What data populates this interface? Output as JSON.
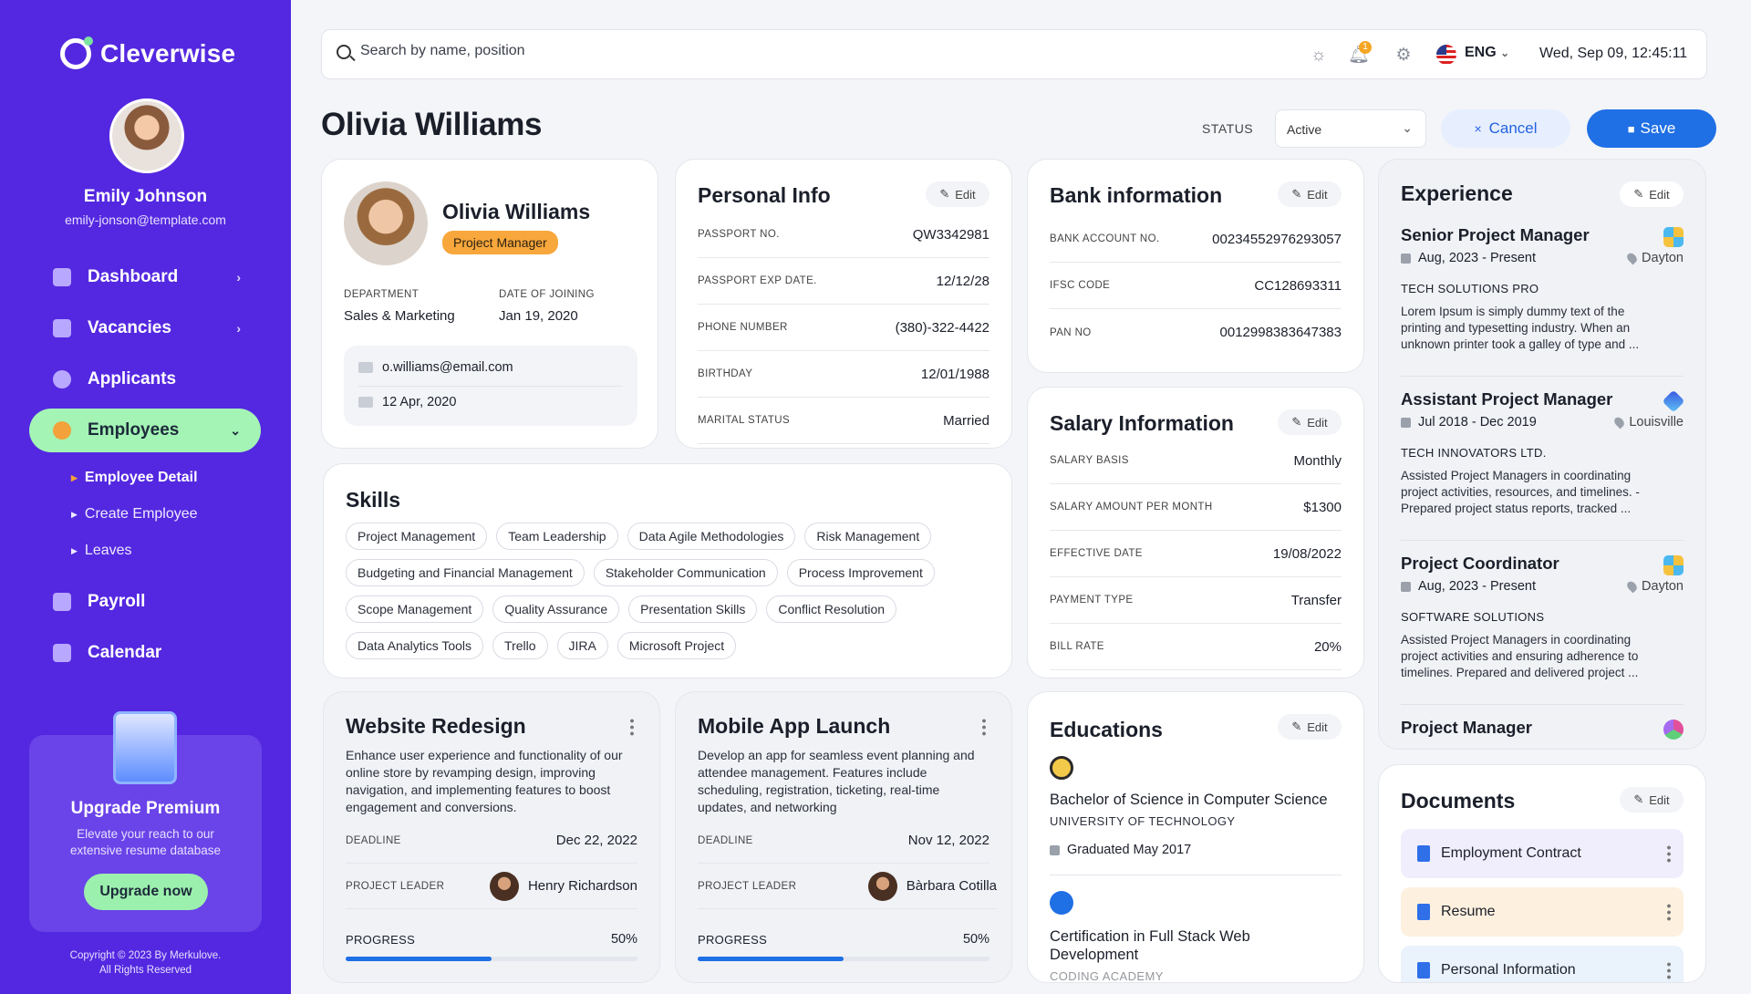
{
  "app": {
    "brand": "Cleverwise"
  },
  "user": {
    "name": "Emily Johnson",
    "email": "emily-jonson@template.com"
  },
  "nav": {
    "items": [
      {
        "label": "Dashboard",
        "icon": "pie-chart-icon"
      },
      {
        "label": "Vacancies",
        "icon": "briefcase-icon"
      },
      {
        "label": "Applicants",
        "icon": "user-icon"
      },
      {
        "label": "Employees",
        "icon": "users-icon"
      },
      {
        "label": "Payroll",
        "icon": "wallet-icon"
      },
      {
        "label": "Calendar",
        "icon": "calendar-icon"
      }
    ],
    "sub": [
      {
        "label": "Employee Detail"
      },
      {
        "label": "Create Employee"
      },
      {
        "label": "Leaves"
      }
    ]
  },
  "premium": {
    "title": "Upgrade Premium",
    "text": "Elevate your reach to our extensive resume database",
    "button": "Upgrade now"
  },
  "copyright": {
    "line1": "Copyright © 2023 By Merkulove.",
    "line2": "All Rights Reserved"
  },
  "topbar": {
    "search_placeholder": "Search by name, position",
    "notif_count": "1",
    "lang": "ENG",
    "datetime": "Wed, Sep 09, 12:45:11"
  },
  "page": {
    "title": "Olivia Williams",
    "status_label": "STATUS",
    "status_value": "Active",
    "cancel": "Cancel",
    "save": "Save"
  },
  "profile": {
    "name": "Olivia Williams",
    "role": "Project Manager",
    "department_label": "DEPARTMENT",
    "department": "Sales & Marketing",
    "joining_label": "DATE OF JOINING",
    "joining": "Jan 19, 2020",
    "email": "o.williams@email.com",
    "date": "12 Apr, 2020"
  },
  "edit_label": "Edit",
  "personal": {
    "title": "Personal Info",
    "rows": [
      {
        "k": "PASSPORT NO.",
        "v": "QW3342981"
      },
      {
        "k": "PASSPORT EXP DATE.",
        "v": "12/12/28"
      },
      {
        "k": "PHONE NUMBER",
        "v": "(380)-322-4422"
      },
      {
        "k": "BIRTHDAY",
        "v": "12/01/1988"
      },
      {
        "k": "MARITAL STATUS",
        "v": "Married"
      }
    ]
  },
  "bank": {
    "title": "Bank information",
    "rows": [
      {
        "k": "BANK ACCOUNT NO.",
        "v": "00234552976293057"
      },
      {
        "k": "IFSC CODE",
        "v": "CC128693311"
      },
      {
        "k": "PAN NO",
        "v": "0012998383647383"
      }
    ]
  },
  "salary": {
    "title": "Salary Information",
    "rows": [
      {
        "k": "SALARY BASIS",
        "v": "Monthly"
      },
      {
        "k": "SALARY AMOUNT PER MONTH",
        "v": "$1300"
      },
      {
        "k": "EFFECTIVE DATE",
        "v": "19/08/2022"
      },
      {
        "k": "PAYMENT TYPE",
        "v": "Transfer"
      },
      {
        "k": "BILL RATE",
        "v": "20%"
      }
    ]
  },
  "skills": {
    "title": "Skills",
    "items": [
      "Project Management",
      "Team Leadership",
      "Data Agile Methodologies",
      "Risk Management",
      "Budgeting and Financial Management",
      "Stakeholder Communication",
      "Process Improvement",
      "Scope Management",
      "Quality Assurance",
      "Presentation Skills",
      "Conflict Resolution",
      "Data Analytics Tools",
      "Trello",
      "JIRA",
      "Microsoft Project"
    ]
  },
  "projects": [
    {
      "title": "Website Redesign",
      "desc": "Enhance user experience and functionality of our online store by revamping design, improving navigation, and implementing features to boost engagement and conversions.",
      "deadline_label": "DEADLINE",
      "deadline": "Dec 22, 2022",
      "leader_label": "PROJECT LEADER",
      "leader": "Henry Richardson",
      "progress_label": "PROGRESS",
      "progress": "50%",
      "progress_value": 50
    },
    {
      "title": "Mobile App Launch",
      "desc": "Develop an app for seamless event planning and attendee management. Features include scheduling, registration, ticketing, real-time updates, and networking",
      "deadline_label": "DEADLINE",
      "deadline": "Nov 12, 2022",
      "leader_label": "PROJECT LEADER",
      "leader": "Bàrbara Cotilla",
      "progress_label": "PROGRESS",
      "progress": "50%",
      "progress_value": 50
    }
  ],
  "education": {
    "title": "Educations",
    "items": [
      {
        "degree": "Bachelor of Science in Computer Science",
        "school": "UNIVERSITY OF TECHNOLOGY",
        "date": "Graduated May 2017"
      },
      {
        "degree": "Certification in Full Stack Web Development",
        "school": "CODING ACADEMY"
      }
    ]
  },
  "experience": {
    "title": "Experience",
    "items": [
      {
        "title": "Senior Project Manager",
        "date": "Aug, 2023 - Present",
        "location": "Dayton",
        "company": "TECH SOLUTIONS PRO",
        "desc": "Lorem Ipsum is simply dummy text of the printing and typesetting industry. When an unknown printer took a galley of type and ..."
      },
      {
        "title": "Assistant Project Manager",
        "date": "Jul 2018 - Dec 2019",
        "location": "Louisville",
        "company": "TECH INNOVATORS LTD.",
        "desc": "Assisted Project Managers in coordinating project activities, resources, and timelines. - Prepared project status reports, tracked ..."
      },
      {
        "title": "Project Coordinator",
        "date": "Aug, 2023 - Present",
        "location": "Dayton",
        "company": "SOFTWARE SOLUTIONS",
        "desc": "Assisted Project Managers in coordinating project activities and ensuring adherence to timelines. Prepared and delivered project ..."
      },
      {
        "title": "Project Manager",
        "date": "",
        "location": "",
        "company": "",
        "desc": ""
      }
    ]
  },
  "documents": {
    "title": "Documents",
    "items": [
      {
        "name": "Employment Contract",
        "color": "#f0eefc"
      },
      {
        "name": "Resume",
        "color": "#fdf0de"
      },
      {
        "name": "Personal Information",
        "color": "#eaf2fc"
      }
    ]
  },
  "colors": {
    "sidebar": "#5428e0",
    "accent": "#1f6fe5",
    "active_nav": "#a4f4b5",
    "role_badge": "#f7a73c"
  }
}
